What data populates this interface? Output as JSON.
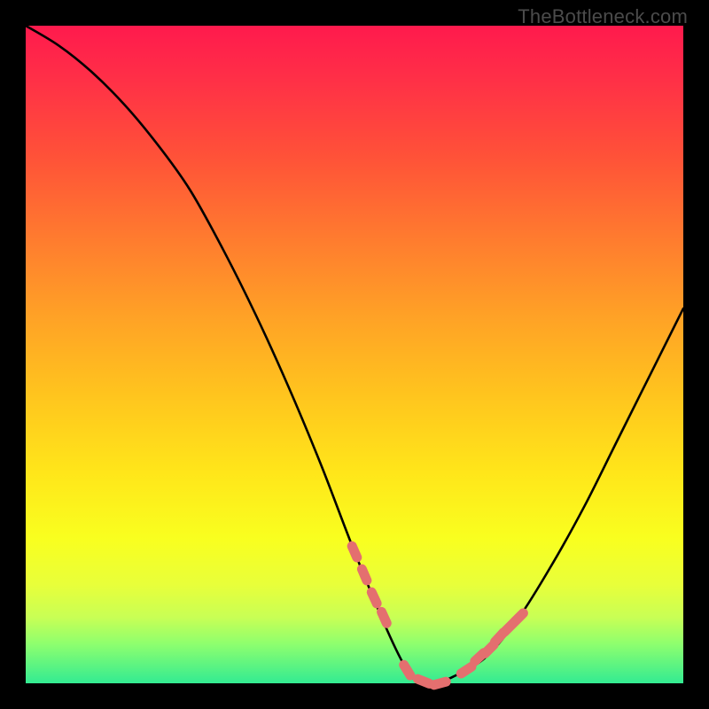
{
  "watermark": "TheBottleneck.com",
  "colors": {
    "background": "#000000",
    "curve": "#000000",
    "marker": "#e46f6f",
    "gradient_top": "#ff1a4d",
    "gradient_bottom": "#33eb92"
  },
  "chart_data": {
    "type": "line",
    "title": "",
    "xlabel": "",
    "ylabel": "",
    "xlim": [
      0,
      100
    ],
    "ylim": [
      0,
      100
    ],
    "series": [
      {
        "name": "bottleneck-curve",
        "x": [
          0,
          5,
          10,
          15,
          20,
          25,
          30,
          35,
          40,
          45,
          50,
          55,
          58,
          60,
          62,
          65,
          70,
          75,
          80,
          85,
          90,
          95,
          100
        ],
        "values": [
          100,
          97,
          93,
          88,
          82,
          75,
          66,
          56,
          45,
          33,
          20,
          8,
          2,
          0,
          0,
          1,
          4,
          10,
          18,
          27,
          37,
          47,
          57
        ]
      }
    ],
    "markers": {
      "name": "highlight-dots",
      "x": [
        50,
        51.5,
        53,
        54.5,
        58,
        60.5,
        63,
        67,
        69,
        70.5,
        72,
        73.5,
        75
      ],
      "values": [
        20,
        16.5,
        13,
        10,
        2,
        0.3,
        0,
        2,
        4,
        5.2,
        7,
        8.5,
        10
      ]
    }
  }
}
